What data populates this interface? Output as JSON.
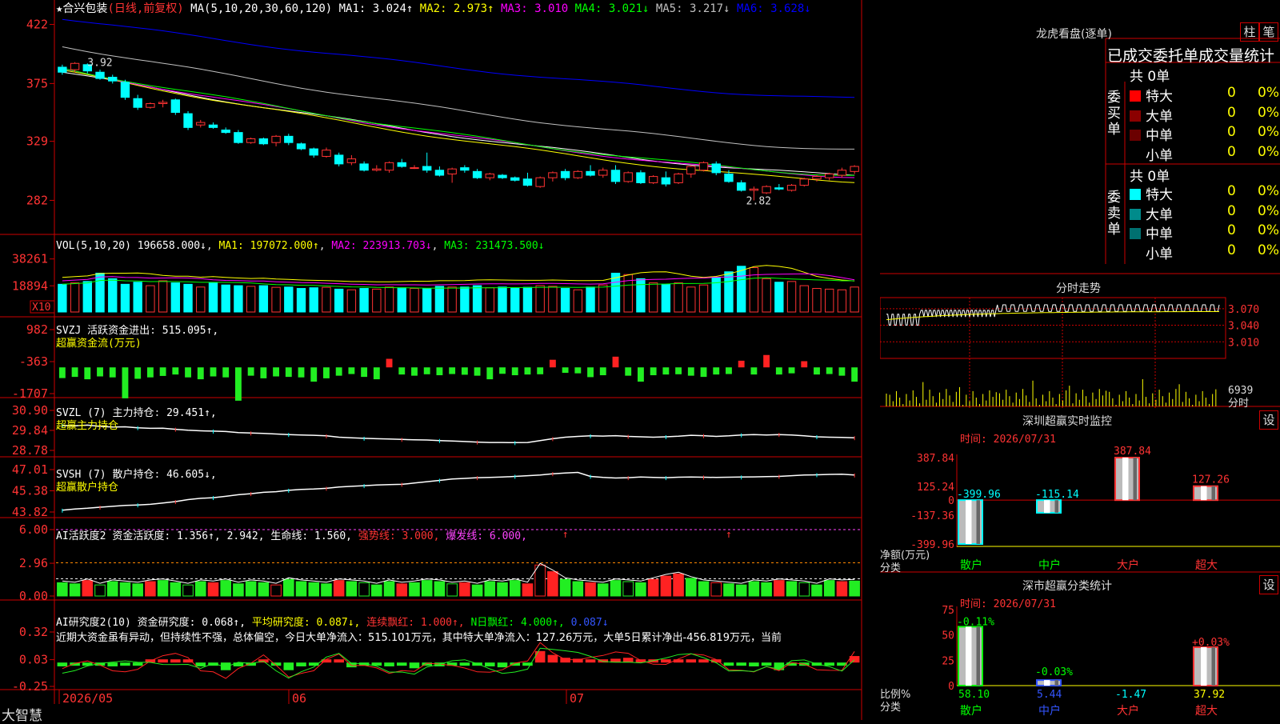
{
  "stock": {
    "name": "★合兴包装",
    "mode": "(日线,前复权)"
  },
  "app_name": "大智慧",
  "chart_data": [
    {
      "type": "candlestick",
      "title": "★合兴包装",
      "ylim": [
        2.6,
        4.3
      ],
      "y_ticks": [
        "422",
        "375",
        "329",
        "282"
      ],
      "ma_header": "MA(5,10,20,30,60,120)",
      "ma_values": [
        {
          "name": "MA1",
          "text": "MA1: 3.024↑",
          "color": "#ffffff"
        },
        {
          "name": "MA2",
          "text": "MA2: 2.973↑",
          "color": "#ffff00"
        },
        {
          "name": "MA3",
          "text": "MA3: 3.010",
          "color": "#ff00ff"
        },
        {
          "name": "MA4",
          "text": "MA4: 3.021↓",
          "color": "#00ff00"
        },
        {
          "name": "MA5",
          "text": "MA5: 3.217↓",
          "color": "#c0c0c0"
        },
        {
          "name": "MA6",
          "text": "MA6: 3.628↓",
          "color": "#0000ff"
        }
      ],
      "annotations": [
        "3.92",
        "2.82"
      ],
      "ohlc": [
        [
          3.88,
          3.9,
          3.82,
          3.84
        ],
        [
          3.86,
          3.92,
          3.84,
          3.91
        ],
        [
          3.9,
          3.91,
          3.83,
          3.85
        ],
        [
          3.84,
          3.86,
          3.78,
          3.79
        ],
        [
          3.8,
          3.82,
          3.75,
          3.77
        ],
        [
          3.76,
          3.78,
          3.62,
          3.64
        ],
        [
          3.63,
          3.66,
          3.54,
          3.56
        ],
        [
          3.56,
          3.6,
          3.55,
          3.59
        ],
        [
          3.59,
          3.62,
          3.56,
          3.6
        ],
        [
          3.62,
          3.63,
          3.5,
          3.52
        ],
        [
          3.51,
          3.53,
          3.38,
          3.4
        ],
        [
          3.42,
          3.46,
          3.4,
          3.44
        ],
        [
          3.42,
          3.44,
          3.39,
          3.4
        ],
        [
          3.38,
          3.4,
          3.35,
          3.36
        ],
        [
          3.36,
          3.38,
          3.27,
          3.28
        ],
        [
          3.28,
          3.32,
          3.27,
          3.31
        ],
        [
          3.31,
          3.32,
          3.26,
          3.27
        ],
        [
          3.28,
          3.34,
          3.25,
          3.33
        ],
        [
          3.33,
          3.35,
          3.26,
          3.28
        ],
        [
          3.27,
          3.28,
          3.22,
          3.23
        ],
        [
          3.23,
          3.24,
          3.16,
          3.18
        ],
        [
          3.17,
          3.24,
          3.16,
          3.22
        ],
        [
          3.18,
          3.2,
          3.09,
          3.11
        ],
        [
          3.12,
          3.18,
          3.1,
          3.15
        ],
        [
          3.11,
          3.13,
          3.05,
          3.06
        ],
        [
          3.06,
          3.1,
          3.05,
          3.07
        ],
        [
          3.06,
          3.13,
          3.04,
          3.12
        ],
        [
          3.12,
          3.15,
          3.08,
          3.09
        ],
        [
          3.08,
          3.1,
          3.07,
          3.08
        ],
        [
          3.09,
          3.2,
          3.04,
          3.06
        ],
        [
          3.06,
          3.09,
          3.01,
          3.02
        ],
        [
          3.03,
          3.08,
          2.96,
          3.07
        ],
        [
          3.08,
          3.1,
          3.04,
          3.06
        ],
        [
          3.05,
          3.07,
          2.99,
          3.0
        ],
        [
          3.0,
          3.04,
          2.98,
          3.03
        ],
        [
          3.02,
          3.03,
          2.99,
          3.0
        ],
        [
          3.0,
          3.01,
          2.97,
          2.98
        ],
        [
          2.99,
          3.04,
          2.93,
          2.94
        ],
        [
          2.93,
          3.01,
          2.92,
          3.0
        ],
        [
          3.0,
          3.05,
          2.97,
          3.04
        ],
        [
          3.05,
          3.07,
          2.98,
          3.0
        ],
        [
          3.0,
          3.06,
          2.99,
          3.05
        ],
        [
          3.05,
          3.1,
          3.01,
          3.02
        ],
        [
          3.02,
          3.08,
          3.0,
          3.06
        ],
        [
          3.06,
          3.1,
          2.95,
          2.97
        ],
        [
          2.97,
          3.05,
          2.96,
          3.04
        ],
        [
          3.04,
          3.06,
          2.95,
          2.96
        ],
        [
          2.96,
          3.02,
          2.95,
          3.01
        ],
        [
          3.0,
          3.05,
          2.93,
          2.95
        ],
        [
          2.96,
          3.04,
          2.95,
          3.03
        ],
        [
          3.03,
          3.1,
          3.0,
          3.09
        ],
        [
          3.06,
          3.13,
          3.05,
          3.12
        ],
        [
          3.11,
          3.13,
          3.02,
          3.04
        ],
        [
          3.03,
          3.06,
          2.96,
          2.97
        ],
        [
          2.96,
          2.98,
          2.89,
          2.9
        ],
        [
          2.9,
          2.93,
          2.82,
          2.91
        ],
        [
          2.88,
          2.94,
          2.87,
          2.93
        ],
        [
          2.92,
          2.95,
          2.9,
          2.91
        ],
        [
          2.9,
          2.95,
          2.89,
          2.94
        ],
        [
          2.94,
          3.0,
          2.93,
          2.99
        ],
        [
          2.99,
          3.02,
          2.97,
          3.01
        ],
        [
          3.0,
          3.04,
          2.98,
          3.03
        ],
        [
          3.02,
          3.08,
          3.0,
          3.06
        ],
        [
          3.05,
          3.1,
          3.03,
          3.09
        ]
      ],
      "ma_lines": [
        {
          "color": "#ffffff",
          "start": 3.84,
          "end": 3.02
        },
        {
          "color": "#ffff00",
          "start": 3.85,
          "end": 2.97
        },
        {
          "color": "#ff00ff",
          "start": 3.86,
          "end": 3.01
        },
        {
          "color": "#00ff00",
          "start": 3.87,
          "end": 3.02
        },
        {
          "color": "#c0c0c0",
          "start": 4.05,
          "end": 3.22
        },
        {
          "color": "#0000ff",
          "start": 4.27,
          "end": 3.63
        }
      ],
      "x_labels": [
        "2026/05",
        "06",
        "07"
      ]
    },
    {
      "type": "bar",
      "title": "VOL(5,10,20)",
      "header_value": "196658.000↓",
      "mas": [
        {
          "text": "MA1: 197072.000↑",
          "color": "#ffff00"
        },
        {
          "text": "MA2: 223913.703↓",
          "color": "#ff00ff"
        },
        {
          "text": "MA3: 231473.500↓",
          "color": "#00ff00"
        }
      ],
      "y_ticks": [
        "38261",
        "18894"
      ],
      "unit_badge": "X10",
      "ylim": [
        0,
        45000
      ],
      "values": [
        20000,
        21000,
        22000,
        28000,
        24000,
        20000,
        21500,
        19000,
        22500,
        21000,
        20000,
        18000,
        21000,
        19500,
        19000,
        18500,
        19000,
        17800,
        18000,
        17000,
        17500,
        17800,
        16500,
        16000,
        17000,
        16500,
        18000,
        17500,
        17000,
        16800,
        18500,
        18000,
        18000,
        19000,
        17500,
        18000,
        17000,
        17800,
        19000,
        18500,
        17000,
        16000,
        18000,
        19500,
        28000,
        27000,
        24000,
        21000,
        20000,
        21000,
        18000,
        19500,
        25000,
        29000,
        33000,
        32000,
        24000,
        21500,
        22000,
        19000,
        17000,
        16500,
        16000,
        18000
      ]
    },
    {
      "type": "bar",
      "title": "SVZJ 活跃资金进出",
      "header_value": "515.095↑,",
      "sub_title": "超赢资金流(万元)",
      "y_ticks": [
        "982",
        "-363",
        "-1707"
      ],
      "ylim": [
        -1707,
        982
      ],
      "values": [
        -450,
        -400,
        -500,
        -380,
        -420,
        -1300,
        -480,
        -420,
        -360,
        -300,
        -420,
        -500,
        -380,
        -420,
        -1400,
        -350,
        -460,
        -380,
        -400,
        -420,
        -600,
        -460,
        -350,
        -280,
        -400,
        -500,
        360,
        -300,
        -350,
        -290,
        -330,
        -280,
        -310,
        -350,
        -500,
        -270,
        -330,
        -300,
        -290,
        320,
        -230,
        -250,
        -410,
        -330,
        450,
        -350,
        -600,
        -330,
        -300,
        -290,
        -350,
        -400,
        -300,
        -280,
        280,
        -300,
        520,
        -300,
        -250,
        260,
        -300,
        -280,
        -350,
        -600
      ]
    },
    {
      "type": "line",
      "title": "SVZL (7) 主力持仓",
      "header_value": "29.451↑,",
      "sub_title": "超赢主力持仓",
      "y_ticks": [
        "30.90",
        "29.84",
        "28.78"
      ],
      "ylim": [
        28.78,
        30.9
      ],
      "values": [
        30.1,
        30.08,
        30.12,
        30.05,
        30.02,
        30.03,
        29.98,
        29.95,
        29.96,
        29.9,
        29.85,
        29.82,
        29.8,
        29.78,
        29.72,
        29.7,
        29.68,
        29.65,
        29.62,
        29.6,
        29.58,
        29.55,
        29.48,
        29.45,
        29.42,
        29.4,
        29.38,
        29.36,
        29.34,
        29.33,
        29.3,
        29.28,
        29.25,
        29.22,
        29.2,
        29.2,
        29.19,
        29.2,
        29.3,
        29.4,
        29.48,
        29.52,
        29.55,
        29.54,
        29.56,
        29.52,
        29.5,
        29.48,
        29.5,
        29.53,
        29.58,
        29.56,
        29.52,
        29.55,
        29.6,
        29.62,
        29.6,
        29.62,
        29.6,
        29.55,
        29.5,
        29.48,
        29.47,
        29.45
      ]
    },
    {
      "type": "line",
      "title": "SVSH (7) 散户持仓",
      "header_value": "46.605↓,",
      "sub_title": "超赢散户持仓",
      "y_ticks": [
        "47.01",
        "45.38",
        "43.82"
      ],
      "ylim": [
        43.82,
        47.01
      ],
      "values": [
        43.95,
        44.05,
        44.1,
        44.18,
        44.25,
        44.32,
        44.35,
        44.4,
        44.5,
        44.6,
        44.75,
        44.85,
        44.9,
        45.0,
        45.12,
        45.2,
        45.3,
        45.35,
        45.45,
        45.52,
        45.55,
        45.6,
        45.7,
        45.75,
        45.8,
        45.85,
        45.88,
        45.9,
        46.0,
        46.1,
        46.2,
        46.3,
        46.35,
        46.4,
        46.42,
        46.45,
        46.5,
        46.55,
        46.6,
        46.7,
        46.75,
        46.8,
        46.5,
        46.42,
        46.38,
        46.4,
        46.45,
        46.42,
        46.4,
        46.44,
        46.45,
        46.44,
        46.42,
        46.44,
        46.45,
        46.46,
        46.48,
        46.5,
        46.55,
        46.6,
        46.62,
        46.65,
        46.66,
        46.6
      ]
    },
    {
      "type": "bar",
      "title": "AI活跃度2",
      "header_parts": [
        {
          "text": "资金活跃度: 1.356↑, 2.942,",
          "color": "#ffffff"
        },
        {
          "text": "生命线: 1.560,",
          "color": "#ffffff"
        },
        {
          "text": "强势线: 3.000,",
          "color": "#ff3333"
        },
        {
          "text": "爆发线: 6.000,",
          "color": "#ff44ff"
        }
      ],
      "y_ticks": [
        "6.00",
        "2.96",
        "0.00"
      ],
      "ylim": [
        0,
        6.0
      ],
      "values": [
        1.2,
        1.1,
        1.4,
        1.0,
        1.3,
        1.2,
        1.1,
        1.3,
        1.4,
        1.2,
        1.0,
        1.3,
        1.2,
        1.4,
        1.1,
        1.3,
        1.2,
        1.0,
        1.5,
        1.3,
        1.2,
        1.1,
        1.4,
        1.3,
        1.2,
        1.0,
        1.3,
        1.1,
        1.2,
        1.4,
        1.3,
        1.1,
        1.2,
        1.0,
        1.3,
        1.2,
        1.4,
        1.1,
        2.8,
        2.2,
        1.5,
        1.3,
        1.2,
        1.1,
        1.4,
        1.3,
        1.2,
        1.5,
        1.8,
        2.0,
        1.6,
        1.3,
        1.2,
        1.1,
        1.0,
        1.3,
        1.2,
        1.4,
        1.3,
        1.2,
        1.0,
        1.4,
        1.3,
        1.356
      ],
      "lines": {
        "strong": 3.0,
        "burst": 6.0,
        "life": 1.56
      }
    },
    {
      "type": "bar",
      "title": "AI研究度2(10)",
      "header_parts": [
        {
          "text": "资金研究度: 0.068↑,",
          "color": "#ffffff"
        },
        {
          "text": "平均研究度: 0.087↓,",
          "color": "#ffff00"
        },
        {
          "text": "连续飘红: 1.000↑,",
          "color": "#ff3333"
        },
        {
          "text": "N日飘红: 4.000↑,",
          "color": "#00ff00"
        },
        {
          "text": "0.087↓",
          "color": "#3355ff"
        }
      ],
      "comment": "近期大资金虽有异动，但持续性不强，总体偏空，今日大单净流入：515.101万元，其中特大单净流入：127.26万元，大单5日累计净出-456.819万元，当前",
      "y_ticks": [
        "0.32",
        "0.03",
        "-0.25"
      ],
      "ylim": [
        -0.25,
        0.32
      ],
      "values": [
        -0.04,
        -0.03,
        -0.02,
        -0.03,
        -0.04,
        -0.03,
        -0.02,
        0.01,
        0.02,
        0.03,
        0.02,
        -0.04,
        -0.03,
        -0.08,
        -0.04,
        -0.03,
        0.02,
        -0.03,
        -0.08,
        -0.04,
        -0.03,
        0.02,
        0.03,
        -0.05,
        -0.03,
        -0.02,
        -0.04,
        -0.03,
        -0.06,
        -0.03,
        -0.04,
        -0.03,
        -0.02,
        -0.03,
        -0.04,
        -0.05,
        -0.03,
        -0.02,
        0.12,
        0.08,
        0.05,
        0.04,
        0.03,
        0.02,
        0.04,
        0.05,
        0.03,
        0.02,
        0.01,
        0.02,
        0.03,
        0.02,
        0.01,
        -0.03,
        -0.02,
        -0.04,
        -0.03,
        -0.08,
        -0.03,
        -0.02,
        -0.03,
        -0.02,
        -0.03,
        0.068
      ]
    },
    {
      "type": "line",
      "title": "分时走势",
      "y_ticks": [
        "3.070",
        "3.040",
        "3.010"
      ],
      "vol_label": "6939",
      "vol_unit": "分时",
      "ylim": [
        2.98,
        3.09
      ]
    },
    {
      "type": "bar",
      "title": "深圳超赢实时监控",
      "time": "时间: 2026/07/31",
      "y_ticks": [
        "387.84",
        "125.24",
        "0",
        "-137.36",
        "-399.96"
      ],
      "ylabel": "净额(万元)",
      "xlabel": "分类",
      "categories": [
        "散户",
        "中户",
        "大户",
        "超大"
      ],
      "values": [
        -399.96,
        -115.14,
        387.84,
        127.26
      ],
      "value_labels": [
        "-399.96",
        "-115.14",
        "387.84",
        "127.26"
      ],
      "ylim": [
        -399.96,
        387.84
      ]
    },
    {
      "type": "bar",
      "title": "深市超赢分类统计",
      "time": "时间: 2026/07/31",
      "y_ticks": [
        "75",
        "50",
        "25",
        "0"
      ],
      "ylabel": "比例%",
      "xlabel": "分类",
      "categories": [
        "散户",
        "中户",
        "大户",
        "超大"
      ],
      "values": [
        58.1,
        5.44,
        -1.47,
        37.92
      ],
      "value_labels": [
        "58.10",
        "5.44",
        "-1.47",
        "37.92"
      ],
      "change_labels": [
        "-0.11%",
        "-0.03%",
        "",
        "+0.03%"
      ],
      "ylim": [
        0,
        75
      ]
    }
  ],
  "longhu": {
    "title": "龙虎看盘(逐单)",
    "btn1": "柱",
    "btn2": "笔",
    "header": "已成交委托单成交量统计",
    "buy_label": "委买单",
    "sell_label": "委卖单",
    "buy_total": "共 0单",
    "sell_total": "共 0单",
    "buy_rows": [
      {
        "label": "特大",
        "count": "0",
        "pct": "0%",
        "color": "#ff0000"
      },
      {
        "label": "大单",
        "count": "0",
        "pct": "0%",
        "color": "#8b0000"
      },
      {
        "label": "中单",
        "count": "0",
        "pct": "0%",
        "color": "#6b0000"
      },
      {
        "label": "小单",
        "count": "0",
        "pct": "0%",
        "color": ""
      }
    ],
    "sell_rows": [
      {
        "label": "特大",
        "count": "0",
        "pct": "0%",
        "color": "#00ffff"
      },
      {
        "label": "大单",
        "count": "0",
        "pct": "0%",
        "color": "#008b8b"
      },
      {
        "label": "中单",
        "count": "0",
        "pct": "0%",
        "color": "#007070"
      },
      {
        "label": "小单",
        "count": "0",
        "pct": "0%",
        "color": ""
      }
    ]
  },
  "settings_button": "设"
}
